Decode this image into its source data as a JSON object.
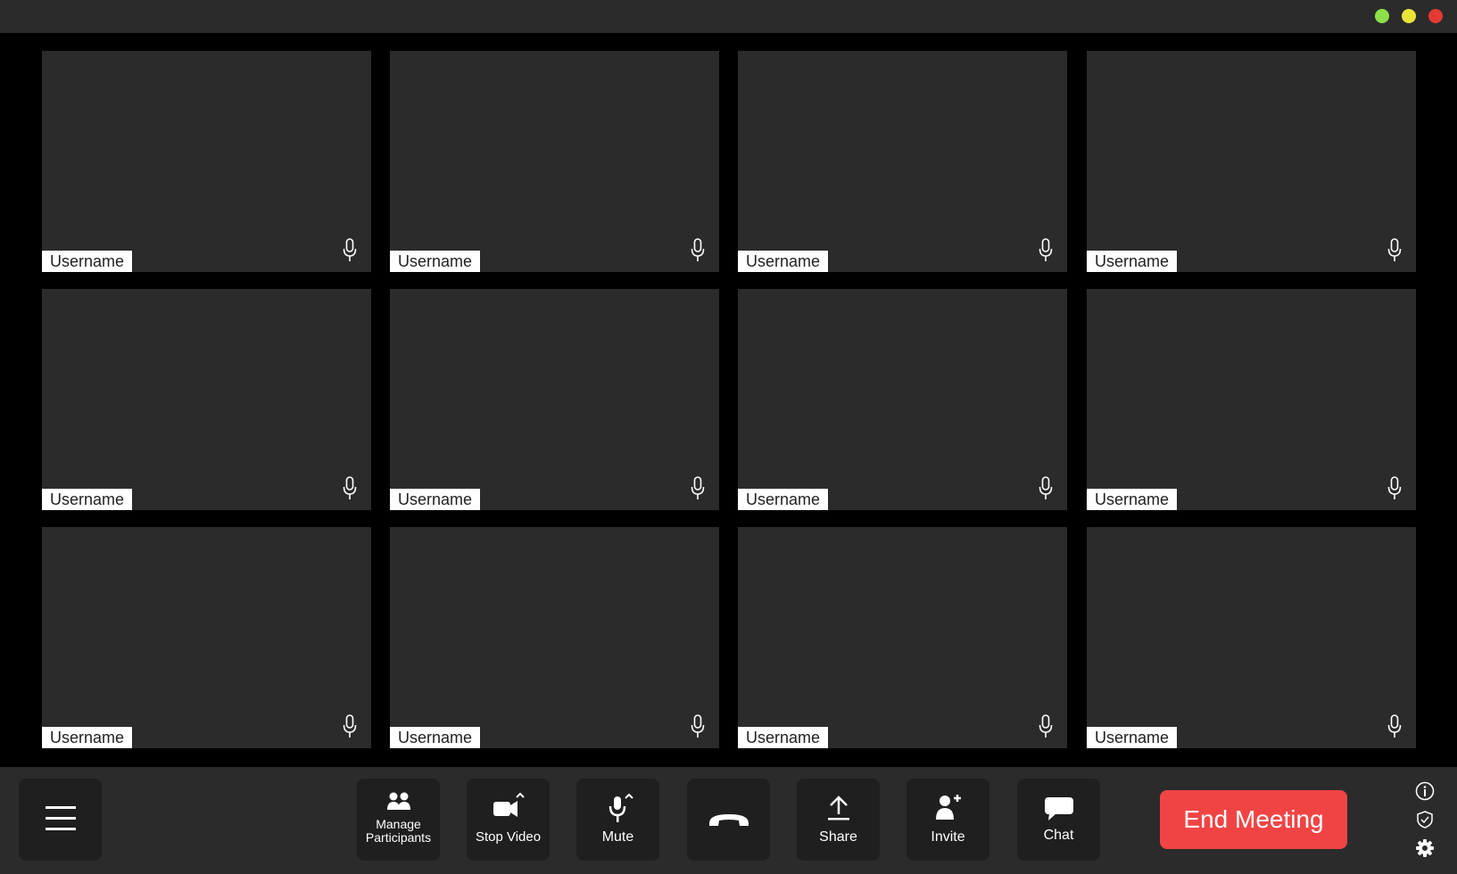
{
  "window": {
    "controls": [
      "minimize-dot",
      "maximize-dot",
      "close-dot"
    ],
    "colors": {
      "green": "#8ee04a",
      "yellow": "#e9e33a",
      "red": "#e53935"
    }
  },
  "participants": [
    {
      "name": "Username",
      "mic": "mic-icon"
    },
    {
      "name": "Username",
      "mic": "mic-icon"
    },
    {
      "name": "Username",
      "mic": "mic-icon"
    },
    {
      "name": "Username",
      "mic": "mic-icon"
    },
    {
      "name": "Username",
      "mic": "mic-icon"
    },
    {
      "name": "Username",
      "mic": "mic-icon"
    },
    {
      "name": "Username",
      "mic": "mic-icon"
    },
    {
      "name": "Username",
      "mic": "mic-icon"
    },
    {
      "name": "Username",
      "mic": "mic-icon"
    },
    {
      "name": "Username",
      "mic": "mic-icon"
    },
    {
      "name": "Username",
      "mic": "mic-icon"
    },
    {
      "name": "Username",
      "mic": "mic-icon"
    }
  ],
  "toolbar": {
    "menu_icon": "hamburger-menu-icon",
    "manage_participants_line1": "Manage",
    "manage_participants_line2": "Participants",
    "stop_video": "Stop Video",
    "mute": "Mute",
    "hangup_icon": "phone-hangup-icon",
    "share": "Share",
    "invite": "Invite",
    "chat": "Chat",
    "end_meeting": "End Meeting",
    "end_meeting_color": "#f04444",
    "side_icons": [
      "info-icon",
      "shield-icon",
      "gear-icon"
    ]
  }
}
